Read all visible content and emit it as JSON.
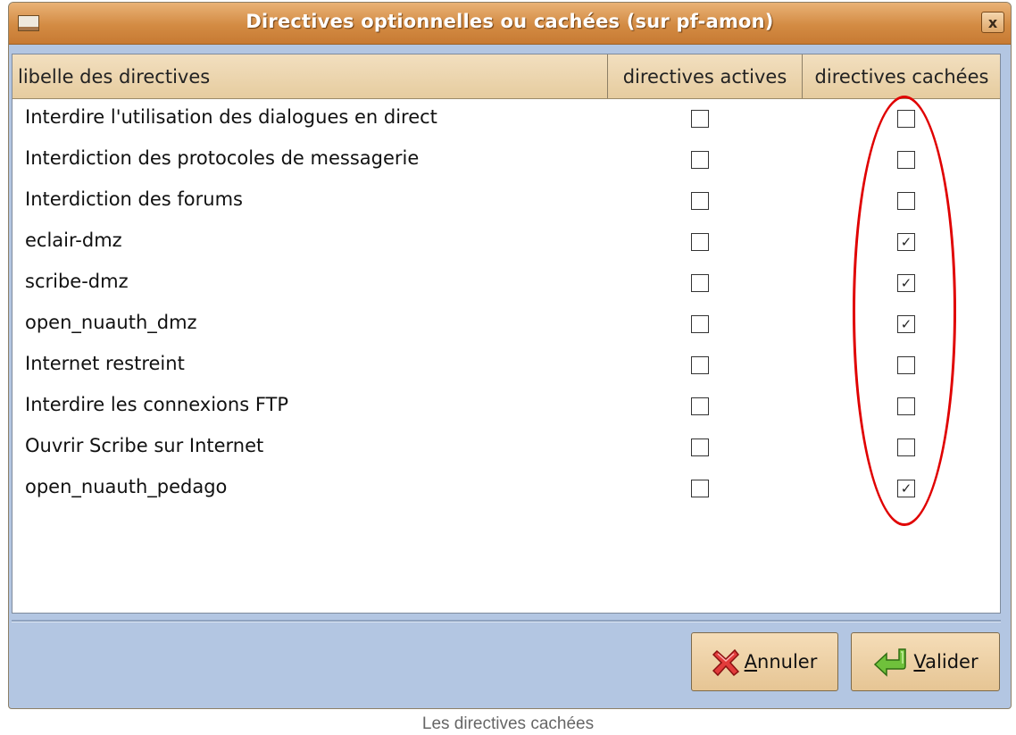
{
  "window": {
    "title": "Directives optionnelles ou cachées (sur pf-amon)",
    "close_label": "x"
  },
  "table": {
    "headers": [
      "libelle des directives",
      "directives actives",
      "directives cachées"
    ],
    "rows": [
      {
        "label": "Interdire l'utilisation des dialogues en direct",
        "active": false,
        "hidden": false
      },
      {
        "label": "Interdiction des protocoles de messagerie",
        "active": false,
        "hidden": false
      },
      {
        "label": "Interdiction des forums",
        "active": false,
        "hidden": false
      },
      {
        "label": "eclair-dmz",
        "active": false,
        "hidden": true
      },
      {
        "label": "scribe-dmz",
        "active": false,
        "hidden": true
      },
      {
        "label": "open_nuauth_dmz",
        "active": false,
        "hidden": true
      },
      {
        "label": "Internet restreint",
        "active": false,
        "hidden": false
      },
      {
        "label": "Interdire les connexions FTP",
        "active": false,
        "hidden": false
      },
      {
        "label": "Ouvrir Scribe sur Internet",
        "active": false,
        "hidden": false
      },
      {
        "label": "open_nuauth_pedago",
        "active": false,
        "hidden": true
      }
    ]
  },
  "buttons": {
    "cancel": {
      "mnemonic": "A",
      "rest": "nnuler",
      "icon": "red-x-icon"
    },
    "ok": {
      "mnemonic": "V",
      "rest": "alider",
      "icon": "green-enter-arrow-icon"
    }
  },
  "annotation": {
    "color": "#e00000",
    "shape": "ellipse around hidden column"
  },
  "caption": "Les directives cachées",
  "colors": {
    "titlebar": "#d38b43",
    "background": "#b3c6e2",
    "header": "#ecd6ae",
    "button": "#eed1a6"
  }
}
